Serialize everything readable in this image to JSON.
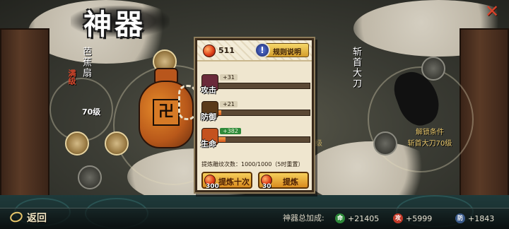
{
  "title": "神器",
  "close_icon": "close-x-icon",
  "left_artifact": {
    "name": "芭蕉扇",
    "tag": "满级",
    "level": "70级"
  },
  "right_artifact": {
    "name": "斩首大刀",
    "unlock_title": "解锁条件",
    "unlock_desc": "斩首大刀70级",
    "hint": "级"
  },
  "panel": {
    "gem_count": "511",
    "rules_label": "规则说明",
    "stats": [
      {
        "label": "攻击",
        "gain": "+31",
        "fill": 0.0,
        "icon": "attack-icon",
        "color": "#6a2a3a"
      },
      {
        "label": "防御",
        "gain": "+21",
        "fill": 0.05,
        "icon": "defense-icon",
        "color": "#5a3a1a"
      },
      {
        "label": "生命",
        "gain": "+382",
        "fill": 0.1,
        "icon": "hp-icon",
        "color": "#c4521e"
      }
    ],
    "refine_count": "提炼雕纹次数：1000/1000（5时重置）",
    "btn_ten": {
      "label": "提炼十次",
      "cost": "300"
    },
    "btn_one": {
      "label": "提炼",
      "cost": "30"
    }
  },
  "bottom": {
    "back_label": "返回",
    "total_label": "神器总加成:",
    "hp": {
      "icon_text": "命",
      "value": "+21405",
      "color": "#2e8a3a"
    },
    "atk": {
      "icon_text": "攻",
      "value": "+5999",
      "color": "#c23a2a"
    },
    "def": {
      "icon_text": "防",
      "value": "+1843",
      "color": "#3a5a8a"
    }
  }
}
